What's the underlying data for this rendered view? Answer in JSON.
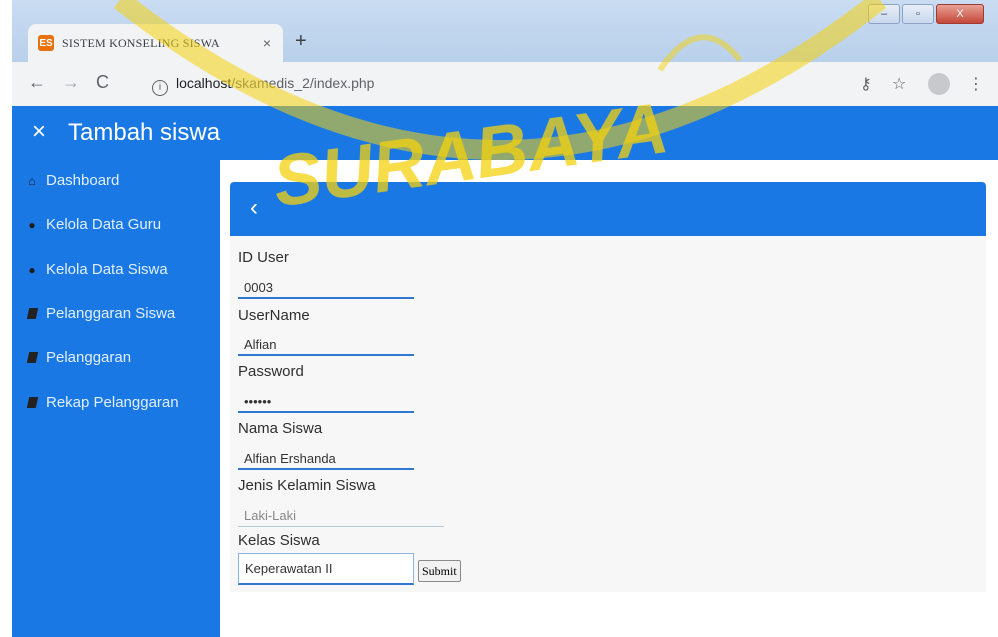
{
  "browser": {
    "tab_title": "SISTEM KONSELING SISWA",
    "tab_close": "×",
    "new_tab": "+",
    "favicon": "ES",
    "url_host": "localhost",
    "url_path": "/skamedis_2/index.php",
    "win_minimize": "–",
    "win_maximize": "▫",
    "win_close": "X"
  },
  "header": {
    "close_icon": "×",
    "title": "Tambah siswa"
  },
  "sidebar": {
    "items": [
      {
        "label": "Dashboard",
        "icon": "home-icon"
      },
      {
        "label": "Kelola Data Guru",
        "icon": "user-icon"
      },
      {
        "label": "Kelola Data Siswa",
        "icon": "user-icon"
      },
      {
        "label": "Pelanggaran Siswa",
        "icon": "book-icon"
      },
      {
        "label": "Pelanggaran",
        "icon": "book-icon"
      },
      {
        "label": "Rekap Pelanggaran",
        "icon": "book-icon"
      }
    ]
  },
  "panel": {
    "back_icon": "‹"
  },
  "form": {
    "fields": [
      {
        "label": "ID User",
        "value": "0003"
      },
      {
        "label": "UserName",
        "value": "Alfian"
      },
      {
        "label": "Password",
        "value": "••••••"
      },
      {
        "label": "Nama Siswa",
        "value": "Alfian Ershanda"
      },
      {
        "label": "Jenis Kelamin Siswa",
        "value": "Laki-Laki"
      },
      {
        "label": "Kelas Siswa",
        "value": "Keperawatan II"
      }
    ],
    "submit_label": "Submit"
  },
  "watermark": {
    "text": "SURABAYA"
  },
  "colors": {
    "primary": "#1a78e5",
    "watermark": "#f4d20e"
  }
}
